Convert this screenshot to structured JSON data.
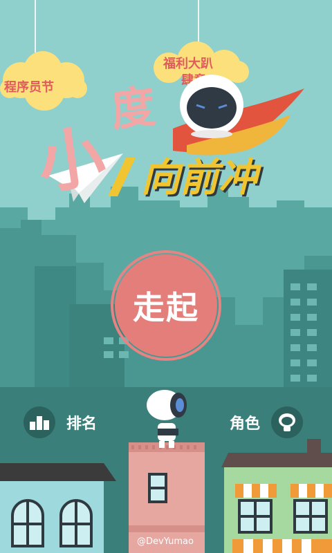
{
  "clouds": {
    "left_label": "程序员节",
    "right_label_line1": "福利大趴",
    "right_label_line2": "肆意"
  },
  "logo": {
    "char_small": "小",
    "char_du": "度",
    "subtitle": "向前冲"
  },
  "start_button": {
    "label": "走起"
  },
  "ranking_button": {
    "label": "排名",
    "icon": "podium-icon"
  },
  "character_button": {
    "label": "角色",
    "icon": "robot-head-icon"
  },
  "watermark": "@DevYumao",
  "colors": {
    "sky": "#8fd0cc",
    "city_back": "#4f9e98",
    "city_front": "#3e8782",
    "accent_pink": "#e37e7a",
    "title_yellow": "#f1c531",
    "cloud_yellow": "#fbe07c"
  }
}
